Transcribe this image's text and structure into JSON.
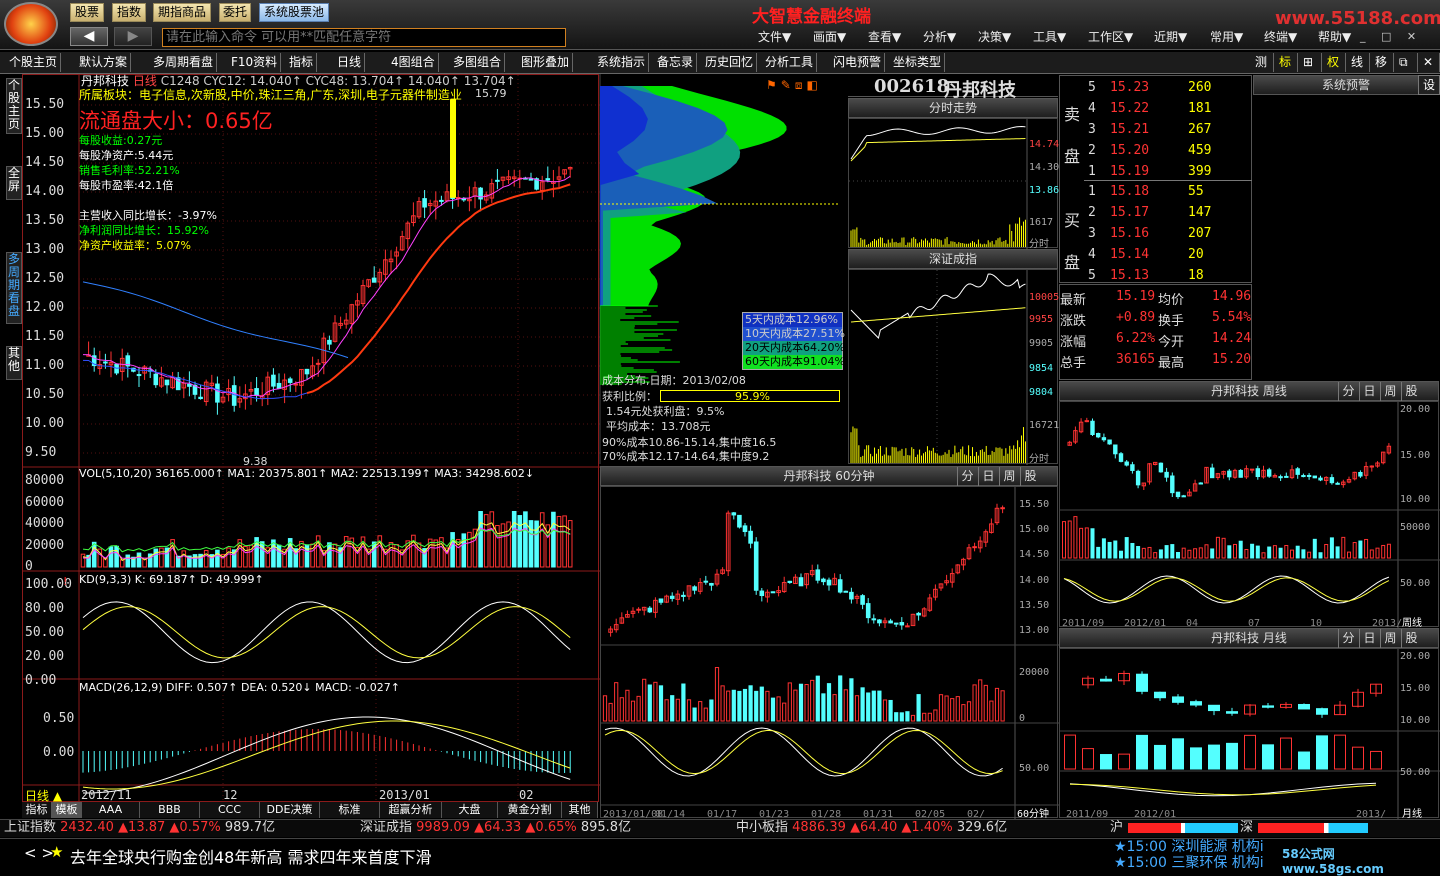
{
  "app": {
    "title": "大智慧金融终端",
    "watermark": "www.55188.com"
  },
  "toolbar": {
    "buttons": [
      "股票",
      "指数",
      "期指商品",
      "委托",
      "系统股票池"
    ],
    "command_placeholder": "请在此输入命令  可以用**匹配任意字符"
  },
  "menu": [
    "文件▼",
    "画面▼",
    "查看▼",
    "分析▼",
    "决策▼",
    "工具▼",
    "工作区▼",
    "近期▼",
    "常用▼",
    "终端▼",
    "帮助▼"
  ],
  "tabs": [
    "个股主页",
    "默认方案",
    "多周期看盘",
    "F10资料",
    "指标",
    "日线",
    "4图组合",
    "多图组合",
    "图形叠加",
    "系统指示",
    "备忘录",
    "历史回忆",
    "分析工具",
    "闪电预警",
    "坐标类型"
  ],
  "right_tools": [
    "测",
    "标",
    "⊞",
    "权",
    "线",
    "移",
    "⧉",
    "✕"
  ],
  "side_tabs": [
    "个股主页",
    "全屏",
    "多周期看盘",
    "其他"
  ],
  "stock": {
    "code": "002618",
    "name": "丹邦科技",
    "cycle": "日线",
    "legend": "C1248 CYC12: 14.040↑ CYC48: 13.704↑ 14.040↑ 13.704↑",
    "sector": "所属板块：电子信息,次新股,中价,珠江三角,广东,深圳,电子元器件制造业",
    "float_cap": "流通盘大小：0.65亿",
    "peak": "15.79",
    "trough": "9.38",
    "fundamentals": [
      "每股收益:0.27元",
      "每股净资产:5.44元",
      "销售毛利率:52.21%",
      "每股市盈率:42.1倍"
    ],
    "growth": [
      "主营收入同比增长：-3.97%",
      "净利润同比增长：15.92%",
      "净资产收益率：5.07%"
    ]
  },
  "price_axis": [
    "15.50",
    "15.00",
    "14.50",
    "14.00",
    "13.50",
    "13.00",
    "12.50",
    "12.00",
    "11.50",
    "11.00",
    "10.50",
    "10.00",
    "9.50"
  ],
  "vol": {
    "legend": "VOL(5,10,20) 36165.000↑ MA1: 20375.801↑ MA2: 22513.199↑ MA3: 34298.602↓",
    "axis": [
      "80000",
      "60000",
      "40000",
      "20000",
      "0"
    ]
  },
  "kd": {
    "legend": "KD(9,3,3) K: 69.187↑ D: 49.999↑",
    "axis": [
      "100.00",
      "80.00",
      "50.00",
      "20.00",
      "0.00"
    ]
  },
  "macd": {
    "legend": "MACD(26,12,9) DIFF: 0.507↑ DEA: 0.520↓ MACD: -0.027↑",
    "axis": [
      "0.50",
      "0.00"
    ]
  },
  "date_axis": [
    "2012/11",
    "12",
    "2013/01",
    "02"
  ],
  "cost": {
    "legend": [
      "5天内成本12.96%",
      "10天内成本27.51%",
      "20天内成本64.20%",
      "60天内成本91.04%"
    ],
    "lines": [
      "成本分布,日期：2013/02/08",
      "获利比例：",
      "1.54元处获利盘：9.5%",
      "平均成本：13.708元",
      "90%成本10.86-15.14,集中度16.5",
      "70%成本12.17-14.64,集中度9.2"
    ],
    "profit": "95.9%"
  },
  "intraday": {
    "title": "分时走势",
    "axis": [
      "14.74",
      "14.30",
      "13.86",
      "1617",
      "分时"
    ]
  },
  "szindex": {
    "title": "深证成指",
    "axis": [
      "10005",
      "9955",
      "9905",
      "9854",
      "9804",
      "16721",
      "分时"
    ]
  },
  "order_book": {
    "sell_label": "卖盘",
    "buy_label": "买盘",
    "asks": [
      [
        "5",
        "15.23",
        "260"
      ],
      [
        "4",
        "15.22",
        "181"
      ],
      [
        "3",
        "15.21",
        "267"
      ],
      [
        "2",
        "15.20",
        "459"
      ],
      [
        "1",
        "15.19",
        "399"
      ]
    ],
    "bids": [
      [
        "1",
        "15.18",
        "55"
      ],
      [
        "2",
        "15.17",
        "147"
      ],
      [
        "3",
        "15.16",
        "207"
      ],
      [
        "4",
        "15.14",
        "20"
      ],
      [
        "5",
        "15.13",
        "18"
      ]
    ]
  },
  "quote": [
    [
      "最新",
      "15.19",
      "均价",
      "14.96"
    ],
    [
      "涨跌",
      "+0.89",
      "换手",
      "5.54%"
    ],
    [
      "涨幅",
      "6.22%",
      "今开",
      "14.24"
    ],
    [
      "总手",
      "36165",
      "最高",
      "15.20"
    ]
  ],
  "alert": "系统预警",
  "m60": {
    "title": "丹邦科技 60分钟",
    "axis": [
      "15.50",
      "15.00",
      "14.50",
      "14.00",
      "13.50",
      "13.00",
      "20000",
      "0",
      "50.00"
    ],
    "dates": [
      "2013/01/08",
      "01/14",
      "01/17",
      "01/23",
      "01/28",
      "01/31",
      "02/05",
      "02/"
    ],
    "period": "60分钟"
  },
  "weekly": {
    "title": "丹邦科技  周线",
    "axis": [
      "20.00",
      "15.00",
      "10.00",
      "50000",
      "50.00"
    ],
    "dates": [
      "2011/09",
      "2012/01",
      "04",
      "07",
      "10",
      "2013/"
    ],
    "period": "周线"
  },
  "monthly": {
    "title": "丹邦科技  月线",
    "axis": [
      "20.00",
      "15.00",
      "10.00",
      "50.00"
    ],
    "dates": [
      "2011/09",
      "2012/01",
      "2013/"
    ],
    "period": "月线"
  },
  "panel_btns": [
    "分",
    "日",
    "周",
    "股"
  ],
  "bottom_tabs": [
    "指标",
    "模板",
    "AAA",
    "BBB",
    "CCC",
    "DDE决策",
    "标准",
    "超赢分析",
    "大盘",
    "黄金分割",
    "其他"
  ],
  "cycle_label": "日线",
  "indices": [
    {
      "name": "上证指数",
      "val": "2432.40",
      "chg": "▲13.87",
      "pct": "▲0.57%",
      "amt": "989.7亿"
    },
    {
      "name": "深证成指",
      "val": "9989.09",
      "chg": "▲64.33",
      "pct": "▲0.65%",
      "amt": "895.8亿"
    },
    {
      "name": "中小板指",
      "val": "4886.39",
      "chg": "▲64.40",
      "pct": "▲1.40%",
      "amt": "329.6亿"
    }
  ],
  "ticker": "去年全球央行购金创48年新高 需求四年来首度下滑",
  "news": [
    "★15:00 深圳能源 机构i",
    "★15:00 三聚环保 机构i"
  ],
  "brand": "58公式网 www.58gs.com",
  "sh_label": "沪",
  "sz_label": "深",
  "colors": {
    "up": "#ff3232",
    "down": "#54ffff",
    "yellow": "#ffff00",
    "green": "#00ff00",
    "bg": "#000000"
  }
}
